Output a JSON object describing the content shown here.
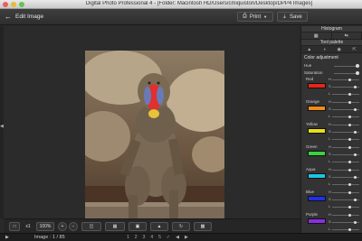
{
  "window": {
    "title": "Digital Photo Professional 4 - [Folder: Macintosh HD/Users/cmiquiston/Desktop/DPP4 Images]"
  },
  "toolbar": {
    "edit_image_label": "Edit Image",
    "print_label": "Print",
    "save_label": "Save"
  },
  "palette": {
    "histogram_label": "Histogram",
    "tool_palette_label": "Tool palette",
    "color_adjustment_label": "Color adjustment",
    "hue_label": "Hue",
    "saturation_label": "Saturation",
    "h_label": "H",
    "s_label": "S",
    "l_label": "L",
    "colors": [
      {
        "name": "Red",
        "swatch": "#e8251a",
        "h_knob": 0.6,
        "s_knob": 0.8,
        "l_knob": 0.6
      },
      {
        "name": "Orange",
        "swatch": "#f08a1c",
        "h_knob": 0.6,
        "s_knob": 0.8,
        "l_knob": 0.6
      },
      {
        "name": "Yellow",
        "swatch": "#e7e01a",
        "h_knob": 0.6,
        "s_knob": 0.8,
        "l_knob": 0.6
      },
      {
        "name": "Green",
        "swatch": "#39d23e",
        "h_knob": 0.6,
        "s_knob": 0.8,
        "l_knob": 0.6
      },
      {
        "name": "Aqua",
        "swatch": "#1cc6e0",
        "h_knob": 0.6,
        "s_knob": 0.8,
        "l_knob": 0.6
      },
      {
        "name": "Blue",
        "swatch": "#2030e8",
        "h_knob": 0.6,
        "s_knob": 0.8,
        "l_knob": 0.6
      },
      {
        "name": "Purple",
        "swatch": "#8a2ee0",
        "h_knob": 0.6,
        "s_knob": 0.8,
        "l_knob": 0.6
      }
    ]
  },
  "bottombar": {
    "zoom_label": "100%",
    "fit_label": "x1"
  },
  "statusbar": {
    "image_count": "Image : 1 / 85"
  }
}
